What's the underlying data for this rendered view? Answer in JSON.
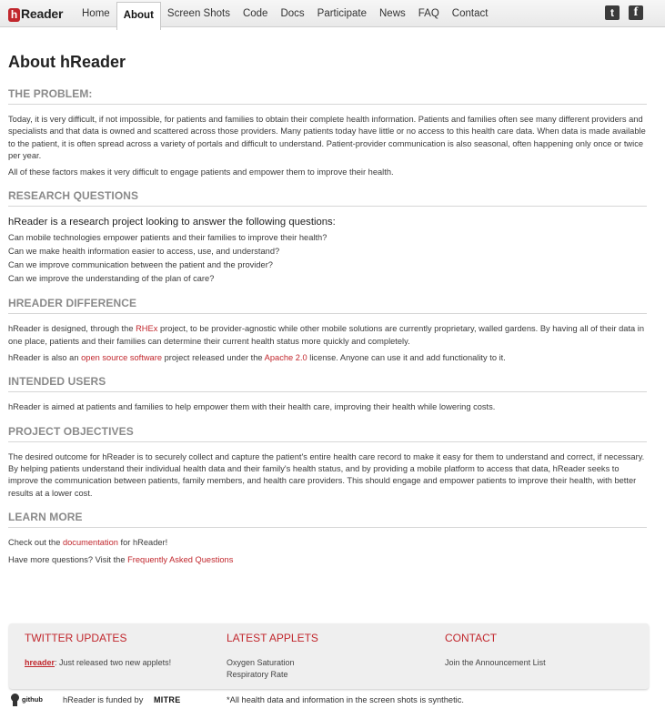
{
  "brand": {
    "h": "h",
    "rest": "Reader"
  },
  "nav": [
    {
      "label": "Home"
    },
    {
      "label": "About",
      "active": true
    },
    {
      "label": "Screen Shots"
    },
    {
      "label": "Code"
    },
    {
      "label": "Docs"
    },
    {
      "label": "Participate"
    },
    {
      "label": "News"
    },
    {
      "label": "FAQ"
    },
    {
      "label": "Contact"
    }
  ],
  "social": {
    "twitter_icon": "t",
    "facebook_icon": "f"
  },
  "page_title": "About hReader",
  "problem": {
    "heading": "The Problem:",
    "p1": "Today, it is very difficult, if not impossible, for patients and families to obtain their complete health information. Patients and families often see many different providers and specialists and that data is owned and scattered across those providers. Many patients today have little or no access to this health care data. When data is made available to the patient, it is often spread across a variety of portals and difficult to understand. Patient-provider communication is also seasonal, often happening only once or twice per year.",
    "p2": "All of these factors makes it very difficult to engage patients and empower them to improve their health."
  },
  "research": {
    "heading": "Research Questions",
    "lead": "hReader is a research project looking to answer the following questions:",
    "questions": [
      "Can mobile technologies empower patients and their families to improve their health?",
      "Can we make health information easier to access, use, and understand?",
      "Can we improve communication between the patient and the provider?",
      "Can we improve the understanding of the plan of care?"
    ]
  },
  "difference": {
    "heading": "hReader Difference",
    "p1_a": "hReader is designed, through the ",
    "p1_link": "RHEx",
    "p1_b": " project, to be provider-agnostic while other mobile solutions are currently proprietary, walled gardens. By having all of their data in one place, patients and their families can determine their current health status more quickly and completely.",
    "p2_a": "hReader is also an ",
    "p2_link1": "open source software",
    "p2_b": " project released under the ",
    "p2_link2": "Apache 2.0",
    "p2_c": " license. Anyone can use it and add functionality to it."
  },
  "users": {
    "heading": "Intended Users",
    "p1": "hReader is aimed at patients and families to help empower them with their health care, improving their health while lowering costs."
  },
  "objectives": {
    "heading": "Project Objectives",
    "p1": "The desired outcome for hReader is to securely collect and capture the patient's entire health care record to make it easy for them to understand and correct, if necessary. By helping patients understand their individual health data and their family's health status, and by providing a mobile platform to access that data, hReader seeks to improve the communication between patients, family members, and health care providers. This should engage and empower patients to improve their health, with better results at a lower cost."
  },
  "learn": {
    "heading": "Learn More",
    "p1_a": "Check out the ",
    "p1_link": "documentation",
    "p1_b": " for hReader!",
    "p2_a": "Have more questions? Visit the ",
    "p2_link": "Frequently Asked Questions"
  },
  "footer": {
    "twitter": {
      "heading": "Twitter Updates",
      "handle": "hreader",
      "text": ": Just released two new applets!"
    },
    "applets": {
      "heading": "Latest Applets",
      "items": [
        "Oxygen Saturation",
        "Respiratory Rate"
      ]
    },
    "contact": {
      "heading": "Contact",
      "item": "Join the Announcement List"
    }
  },
  "bottom": {
    "github": "github",
    "funded": "hReader is funded by",
    "mitre": "MITRE",
    "disclaimer": "*All health data and information in the screen shots is synthetic."
  },
  "colors": {
    "accent": "#c1272d",
    "heading_gray": "#8a8a8a"
  }
}
